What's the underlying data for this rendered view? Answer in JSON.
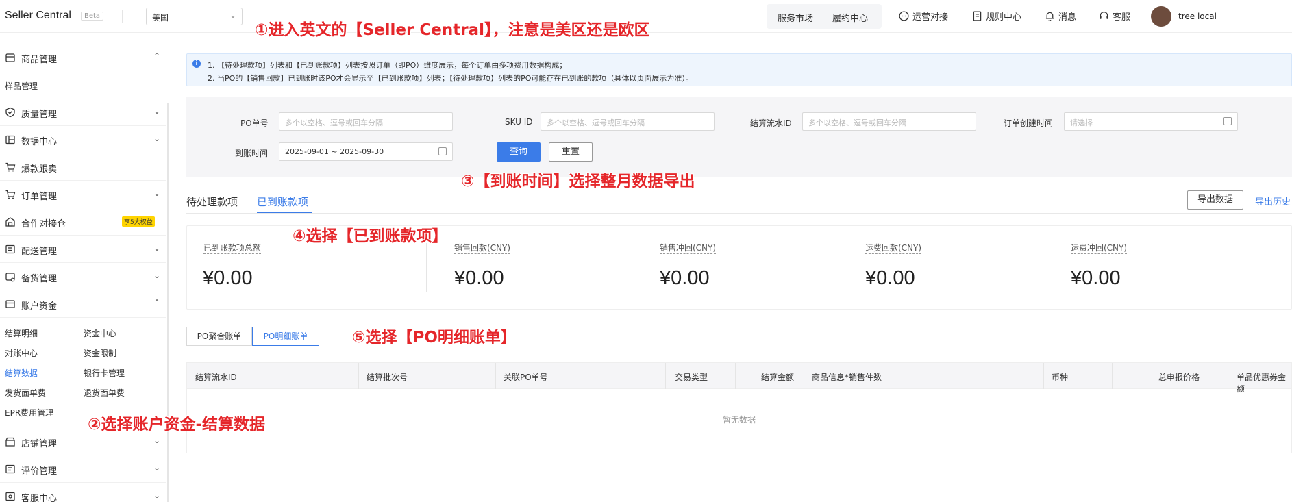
{
  "topbar": {
    "brand": "Seller Central",
    "beta": "Beta",
    "region": "美国",
    "nav": [
      "服务市场",
      "履约中心"
    ],
    "items": [
      {
        "icon": "chat-icon",
        "label": "运营对接"
      },
      {
        "icon": "document-icon",
        "label": "规则中心"
      },
      {
        "icon": "bell-icon",
        "label": "消息"
      },
      {
        "icon": "headset-icon",
        "label": "客服"
      }
    ],
    "user": "tree local"
  },
  "sidebar": {
    "menus": [
      {
        "label": "商品管理",
        "icon": "box-icon",
        "arrow": "up"
      },
      {
        "label": "质量管理",
        "icon": "shield-icon",
        "arrow": "down"
      },
      {
        "label": "数据中心",
        "icon": "chart-icon",
        "arrow": "down"
      },
      {
        "label": "爆款跟卖",
        "icon": "cart-icon",
        "arrow": ""
      },
      {
        "label": "订单管理",
        "icon": "order-icon",
        "arrow": "down"
      },
      {
        "label": "合作对接仓",
        "icon": "warehouse-icon",
        "arrow": "",
        "badge": "享5大权益"
      },
      {
        "label": "配送管理",
        "icon": "truck-icon",
        "arrow": "down"
      },
      {
        "label": "备货管理",
        "icon": "stock-icon",
        "arrow": "down"
      },
      {
        "label": "账户资金",
        "icon": "wallet-icon",
        "arrow": "up"
      },
      {
        "label": "店铺管理",
        "icon": "store-icon",
        "arrow": "down"
      },
      {
        "label": "评价管理",
        "icon": "review-icon",
        "arrow": "down"
      },
      {
        "label": "客服中心",
        "icon": "service-icon",
        "arrow": "down"
      }
    ],
    "product_sub": "样品管理",
    "account_sub": [
      "结算明细",
      "资金中心",
      "对账中心",
      "资金限制",
      "结算数据",
      "银行卡管理",
      "发货面单费",
      "退货面单费",
      "EPR费用管理"
    ]
  },
  "notice": {
    "line1": "1. 【待处理款项】列表和【已到账款项】列表按照订单（即PO）维度展示，每个订单由多项费用数据构成；",
    "line2": "2. 当PO的【销售回款】已到账时该PO才会显示至【已到账款项】列表；【待处理款项】列表的PO可能存在已到账的款项（具体以页面展示为准）。"
  },
  "filters": {
    "po_label": "PO单号",
    "po_placeholder": "多个以空格、逗号或回车分隔",
    "sku_label": "SKU ID",
    "sku_placeholder": "多个以空格、逗号或回车分隔",
    "flow_label": "结算流水ID",
    "flow_placeholder": "多个以空格、逗号或回车分隔",
    "created_label": "订单创建时间",
    "created_placeholder": "请选择",
    "arrival_label": "到账时间",
    "arrival_value": "2025-09-01 ~ 2025-09-30",
    "search": "查询",
    "reset": "重置"
  },
  "tabs": [
    "待处理款项",
    "已到账款项"
  ],
  "export": "导出数据",
  "export_history": "导出历史",
  "stats": [
    {
      "label": "已到账款项总额",
      "value": "¥0.00"
    },
    {
      "label": "销售回款(CNY)",
      "value": "¥0.00"
    },
    {
      "label": "销售冲回(CNY)",
      "value": "¥0.00"
    },
    {
      "label": "运费回款(CNY)",
      "value": "¥0.00"
    },
    {
      "label": "运费冲回(CNY)",
      "value": "¥0.00"
    }
  ],
  "subtabs": [
    "PO聚合账单",
    "PO明细账单"
  ],
  "table": {
    "columns": [
      "结算流水ID",
      "结算批次号",
      "关联PO单号",
      "交易类型",
      "结算金额",
      "商品信息*销售件数",
      "币种",
      "总申报价格",
      "单品优惠券金额"
    ],
    "empty": "暂无数据"
  },
  "annotations": [
    "①进入英文的【Seller Central】，注意是美区还是欧区",
    "②选择账户资金-结算数据",
    "③【到账时间】选择整月数据导出",
    "④选择【已到账款项】",
    "⑤选择【PO明细账单】"
  ],
  "colors": {
    "accent": "#3b7ce8",
    "annotation": "#e5262a",
    "badge": "#ffd400"
  }
}
